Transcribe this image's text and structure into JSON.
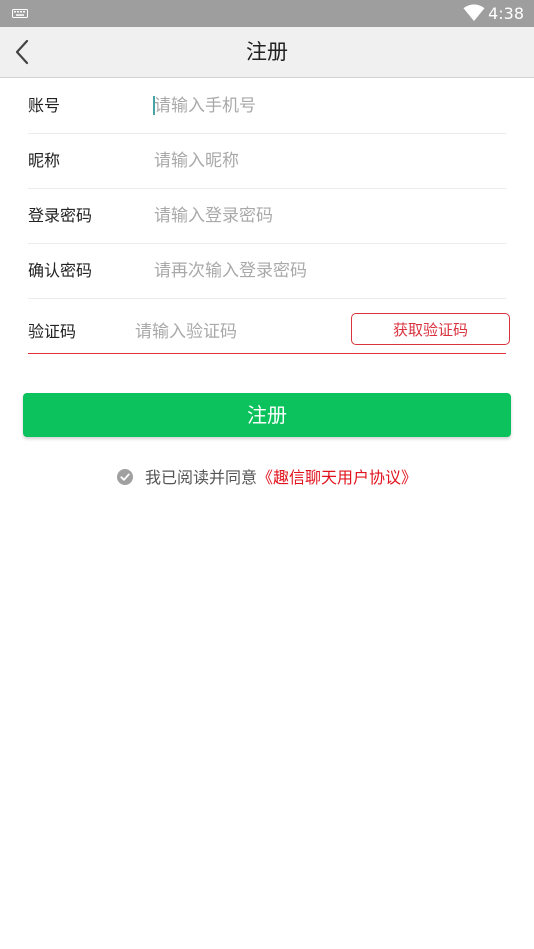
{
  "status_bar": {
    "time": "4:38",
    "icons": [
      "keyboard-icon",
      "wifi-icon"
    ]
  },
  "header": {
    "title": "注册",
    "back_icon": "chevron-left-icon"
  },
  "form": {
    "account": {
      "label": "账号",
      "placeholder": "请输入手机号"
    },
    "nickname": {
      "label": "昵称",
      "placeholder": "请输入昵称"
    },
    "password": {
      "label": "登录密码",
      "placeholder": "请输入登录密码"
    },
    "confirm_password": {
      "label": "确认密码",
      "placeholder": "请再次输入登录密码"
    },
    "verify_code": {
      "label": "验证码",
      "placeholder": "请输入验证码",
      "button_label": "获取验证码"
    }
  },
  "submit_label": "注册",
  "agreement": {
    "prefix": "我已阅读并同意",
    "link": "《趣信聊天用户协议》",
    "check_icon": "checkmark-circle-icon"
  },
  "colors": {
    "primary_green": "#0bc25c",
    "accent_red": "#d9333f",
    "link_red": "#e1141e",
    "status_bar": "#9e9e9e",
    "nav_bar": "#f0f0f0"
  }
}
